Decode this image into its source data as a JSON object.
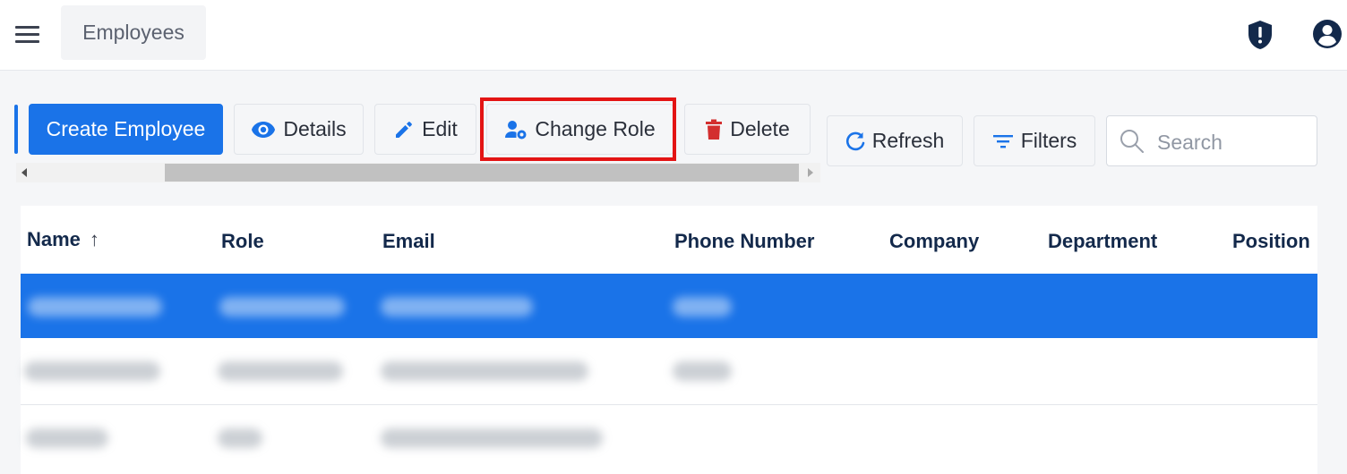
{
  "header": {
    "breadcrumb": "Employees",
    "icons": {
      "menu": "hamburger-icon",
      "security": "shield-alert-icon",
      "account": "account-circle-icon"
    }
  },
  "toolbar": {
    "create_label": "Create Employee",
    "details_label": "Details",
    "edit_label": "Edit",
    "change_role_label": "Change Role",
    "delete_label": "Delete",
    "refresh_label": "Refresh",
    "filters_label": "Filters",
    "search_placeholder": "Search"
  },
  "table": {
    "columns": [
      "Name",
      "Role",
      "Email",
      "Phone Number",
      "Company",
      "Department",
      "Position"
    ],
    "sorted_column": "Name",
    "sort_direction": "ascending"
  },
  "colors": {
    "accent": "#1a73e8",
    "highlight": "#e31414",
    "delete_icon": "#d32f2f",
    "header_text": "#13294b"
  }
}
